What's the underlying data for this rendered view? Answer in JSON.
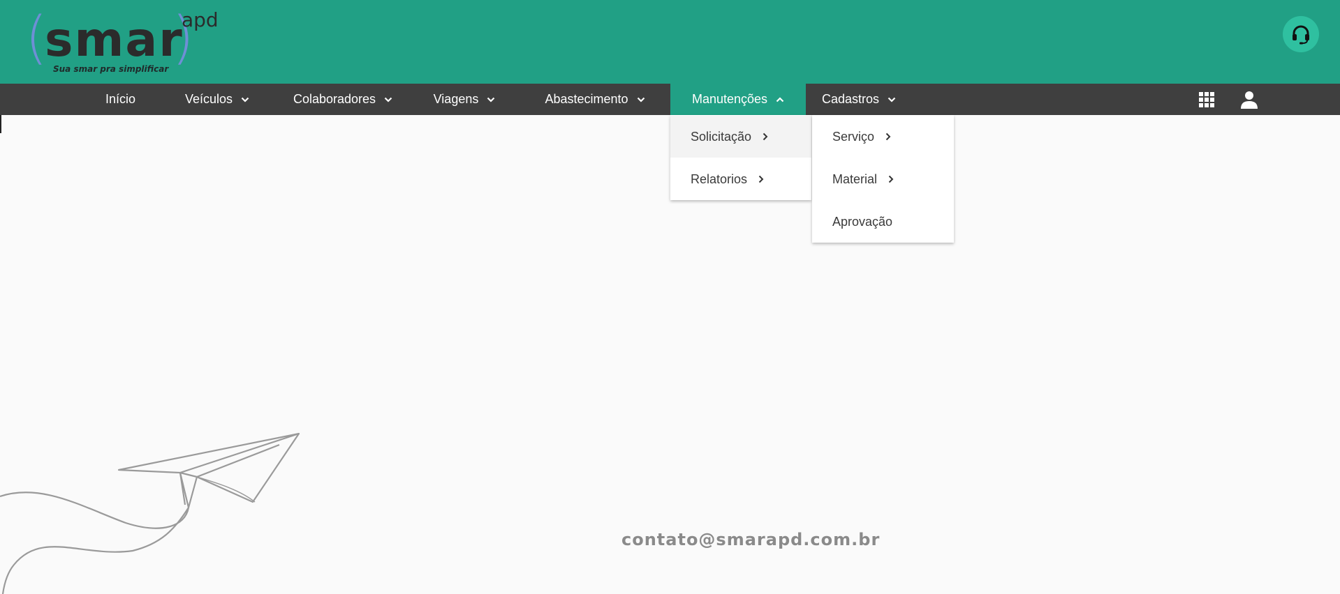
{
  "logo": {
    "open_paren": "(",
    "word": "smar",
    "close_paren": ")",
    "superscript": "apd",
    "tagline": "Sua smar pra simplificar"
  },
  "header": {
    "support_icon": "headset-icon"
  },
  "nav": {
    "items": [
      {
        "label": "Início"
      },
      {
        "label": "Veículos"
      },
      {
        "label": "Colaboradores"
      },
      {
        "label": "Viagens"
      },
      {
        "label": "Abastecimento"
      },
      {
        "label": "Manutenções"
      },
      {
        "label": "Cadastros"
      }
    ],
    "active": "Manutenções",
    "apps_icon": "apps-grid-icon",
    "user_icon": "user-icon"
  },
  "menu_manutencoes": {
    "items": [
      {
        "label": "Solicitação"
      },
      {
        "label": "Relatorios"
      }
    ]
  },
  "submenu_cadastros": {
    "items": [
      {
        "label": "Serviço"
      },
      {
        "label": "Material"
      },
      {
        "label": "Aprovação"
      }
    ]
  },
  "footer": {
    "contact": "contato@smarapd.com.br",
    "illustration": "paper-plane-illustration"
  },
  "colors": {
    "header": "#21a085",
    "nav": "#3f3f3f",
    "active_nav": "#21a085",
    "support_button": "#2fc0a0"
  }
}
